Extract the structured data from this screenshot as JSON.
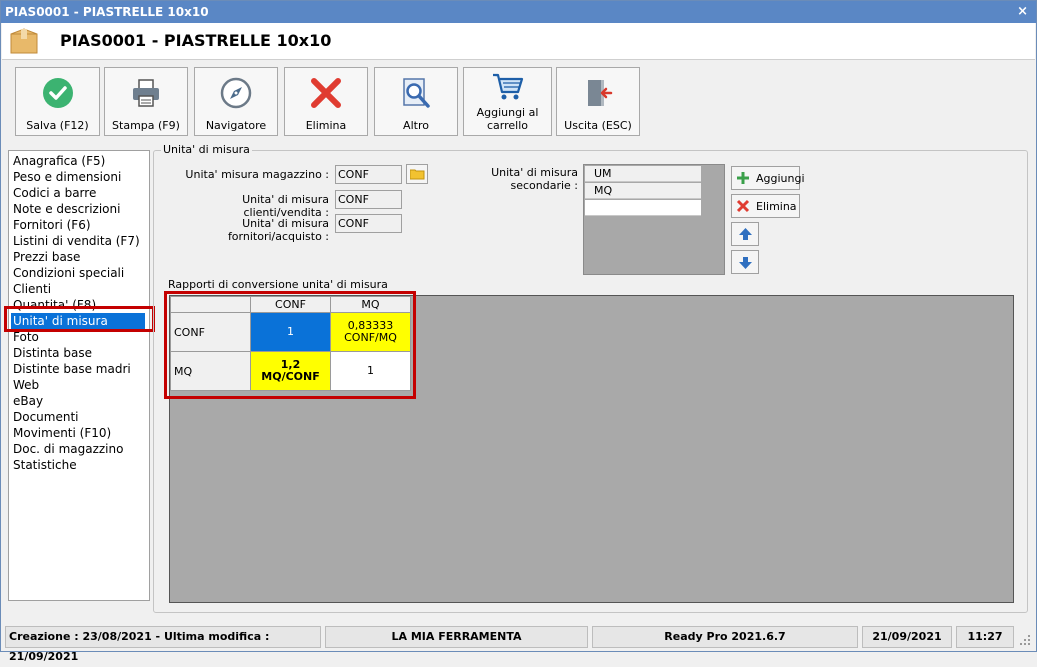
{
  "window": {
    "title": "PIAS0001 - PIASTRELLE 10x10",
    "close_glyph": "×"
  },
  "header": {
    "title": "PIAS0001 - PIASTRELLE 10x10",
    "icon": "box-icon"
  },
  "toolbar": {
    "save": "Salva (F12)",
    "print": "Stampa (F9)",
    "navigator": "Navigatore",
    "delete": "Elimina",
    "other": "Altro",
    "add_to_cart_line1": "Aggiungi al",
    "add_to_cart_line2": "carrello",
    "exit": "Uscita (ESC)"
  },
  "sidebar": {
    "items": [
      "Anagrafica (F5)",
      "Peso e dimensioni",
      "Codici a barre",
      "Note e descrizioni",
      "Fornitori (F6)",
      "Listini di vendita (F7)",
      "Prezzi base",
      "Condizioni speciali",
      "Clienti",
      "Quantita' (F8)",
      "Unita' di misura",
      "Foto",
      "Distinta base",
      "Distinte base madri",
      "Web",
      "eBay",
      "Documenti",
      "Movimenti (F10)",
      "Doc. di magazzino",
      "Statistiche"
    ],
    "selected": "Unita' di misura"
  },
  "main": {
    "group_title": "Unita' di misura",
    "warehouse_label": "Unita' misura magazzino :",
    "warehouse_value": "CONF",
    "customers_label": "Unita' di misura clienti/vendita :",
    "customers_value": "CONF",
    "suppliers_label": "Unita' di misura fornitori/acquisto :",
    "suppliers_value": "CONF",
    "secondary_label": "Unita' di misura secondarie :",
    "secondary_rows": [
      "UM",
      "MQ",
      ""
    ],
    "add_button": "Aggiungi",
    "delete_button": "Elimina",
    "conversion_title": "Rapporti di conversione unita' di misura",
    "conversion": {
      "columns": [
        "CONF",
        "MQ"
      ],
      "rows": [
        {
          "label": "CONF",
          "cells": [
            {
              "text": "1",
              "line2": "",
              "color": "#0a72d8",
              "text_color": "#ffffff",
              "bold": false
            },
            {
              "text": "0,83333",
              "line2": "CONF/MQ",
              "color": "#ffff00",
              "text_color": "#000000",
              "bold": false
            }
          ]
        },
        {
          "label": "MQ",
          "cells": [
            {
              "text": "1,2",
              "line2": "MQ/CONF",
              "color": "#ffff00",
              "text_color": "#000000",
              "bold": true
            },
            {
              "text": "1",
              "line2": "",
              "color": "#ffffff",
              "text_color": "#000000",
              "bold": false
            }
          ]
        }
      ]
    }
  },
  "statusbar": {
    "dates": "Creazione : 23/08/2021 - Ultima modifica : 21/09/2021",
    "company": "LA MIA FERRAMENTA",
    "version": "Ready Pro 2021.6.7",
    "date": "21/09/2021",
    "time": "11:27"
  },
  "colors": {
    "titlebar": "#5a87c5",
    "selection": "#0a72d8",
    "highlight_box": "#c40000",
    "yellow_cell": "#ffff00"
  }
}
